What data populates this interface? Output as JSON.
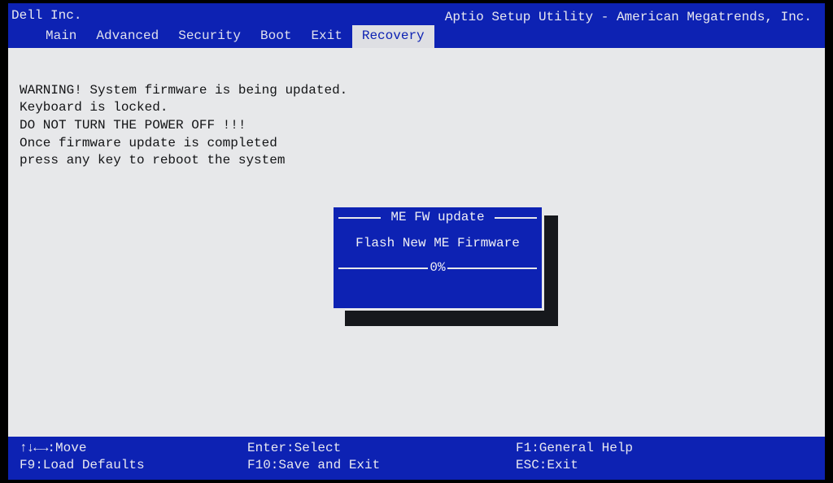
{
  "header": {
    "vendor": "Dell Inc.",
    "title": "Aptio Setup Utility - American Megatrends, Inc.",
    "tabs": [
      {
        "label": "Main",
        "active": false
      },
      {
        "label": "Advanced",
        "active": false
      },
      {
        "label": "Security",
        "active": false
      },
      {
        "label": "Boot",
        "active": false
      },
      {
        "label": "Exit",
        "active": false
      },
      {
        "label": "Recovery",
        "active": true
      }
    ]
  },
  "content": {
    "lines": [
      "WARNING! System firmware is being updated.",
      "Keyboard is locked.",
      "DO NOT TURN THE POWER OFF !!!",
      "Once firmware update is completed",
      "press any key to reboot the system"
    ]
  },
  "dialog": {
    "title": "ME FW update",
    "message": "Flash New ME Firmware",
    "progress_percent": 0,
    "progress_text": "0%"
  },
  "footer": {
    "row1": {
      "col1_prefix_glyph": "↑↓←→",
      "col1": ":Move",
      "col2": "Enter:Select",
      "col3": "F1:General Help"
    },
    "row2": {
      "col1": "F9:Load Defaults",
      "col2": "F10:Save and Exit",
      "col3": "ESC:Exit"
    }
  }
}
